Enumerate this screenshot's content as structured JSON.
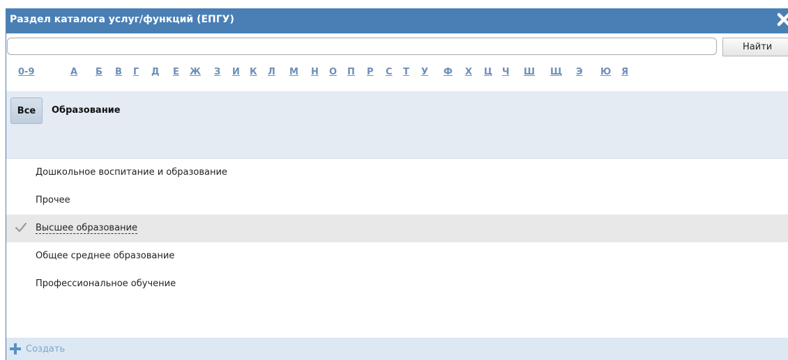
{
  "window": {
    "title": "Раздел каталога услуг/функций (ЕПГУ)"
  },
  "search": {
    "value": "",
    "placeholder": "",
    "button_label": "Найти"
  },
  "alphabet": [
    "0-9",
    "А",
    "Б",
    "В",
    "Г",
    "Д",
    "Е",
    "Ж",
    "З",
    "И",
    "К",
    "Л",
    "М",
    "Н",
    "О",
    "П",
    "Р",
    "С",
    "Т",
    "У",
    "Ф",
    "Х",
    "Ц",
    "Ч",
    "Ш",
    "Щ",
    "Э",
    "Ю",
    "Я"
  ],
  "filter": {
    "all_label": "Все",
    "current_section": "Образование"
  },
  "list": {
    "items": [
      {
        "label": "Дошкольное воспитание и образование",
        "selected": false
      },
      {
        "label": "Прочее",
        "selected": false
      },
      {
        "label": "Высшее образование",
        "selected": true
      },
      {
        "label": "Общее среднее образование",
        "selected": false
      },
      {
        "label": "Профессиональное обучение",
        "selected": false
      }
    ]
  },
  "footer": {
    "create_label": "Создать"
  },
  "colors": {
    "titlebar": "#4a7fb5",
    "filter_bar": "#e5ebf3",
    "footer": "#dce8f3",
    "link": "#6b8fb9",
    "create": "#7fa6cb",
    "selected_row": "#e8e8e8"
  }
}
